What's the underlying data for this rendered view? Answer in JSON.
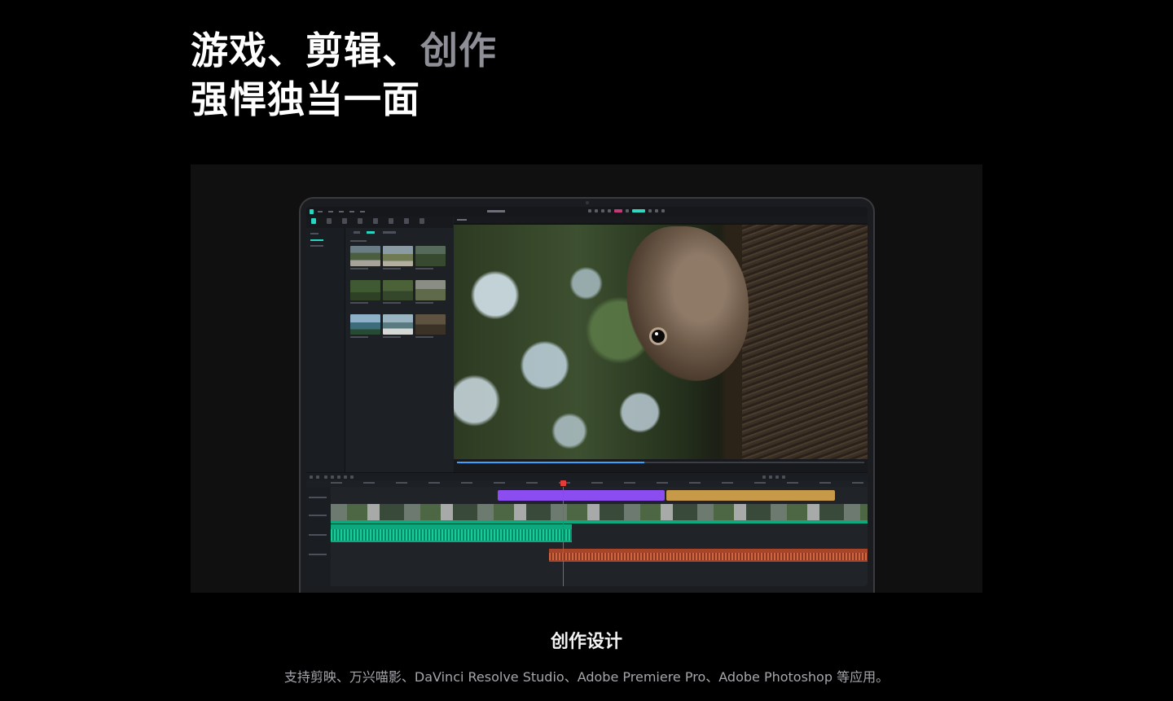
{
  "headline": {
    "line1_part1": "游戏、剪辑、",
    "line1_part2": "创作",
    "line2": "强悍独当一面"
  },
  "feature": {
    "title": "创作设计",
    "description": "支持剪映、万兴喵影、DaVinci Resolve Studio、Adobe Premiere Pro、Adobe Photoshop 等应用。"
  },
  "colors": {
    "background": "#000000",
    "accent_teal": "#2ad4c0",
    "clip_purple": "#8b4cf0",
    "clip_gold": "#c79a4a",
    "audio_green": "#0fa77e",
    "audio_orange": "#a7452b",
    "playhead": "#e43b3b"
  }
}
